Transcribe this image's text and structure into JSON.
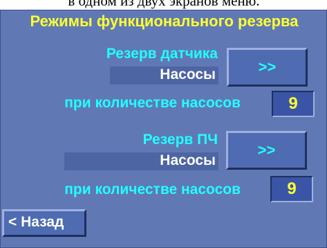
{
  "doc_caption": "в одном из двух экранов меню.",
  "screen": {
    "title": "Режимы функционального резерва",
    "sensor_reserve": {
      "label": "Резерв датчика",
      "value": "Насосы",
      "button_label": ">>",
      "count_label": "при количестве насосов",
      "count_value": "9"
    },
    "fc_reserve": {
      "label": "Резерв ПЧ",
      "value": "Насосы",
      "button_label": ">>",
      "count_label": "при количестве насосов",
      "count_value": "9"
    },
    "back_label": "< Назад"
  },
  "colors": {
    "panel_bg": "#6079b5",
    "title": "#ffff33",
    "label": "#22ffff",
    "value_text": "#ffffff",
    "number": "#ffff33"
  }
}
